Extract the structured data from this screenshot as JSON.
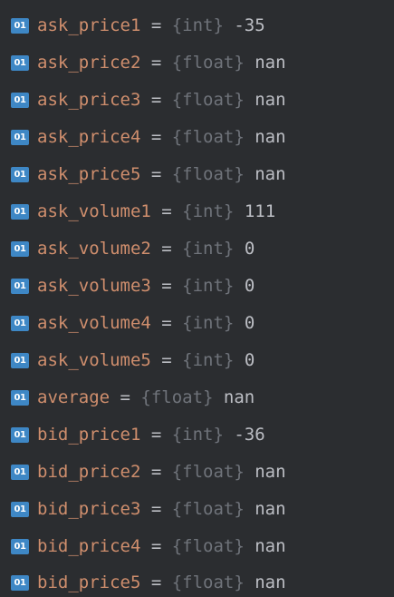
{
  "variables": [
    {
      "icon": "01",
      "name": "ask_price1",
      "eq": " = ",
      "type": "{int}",
      "value": " -35"
    },
    {
      "icon": "01",
      "name": "ask_price2",
      "eq": " = ",
      "type": "{float}",
      "value": " nan"
    },
    {
      "icon": "01",
      "name": "ask_price3",
      "eq": " = ",
      "type": "{float}",
      "value": " nan"
    },
    {
      "icon": "01",
      "name": "ask_price4",
      "eq": " = ",
      "type": "{float}",
      "value": " nan"
    },
    {
      "icon": "01",
      "name": "ask_price5",
      "eq": " = ",
      "type": "{float}",
      "value": " nan"
    },
    {
      "icon": "01",
      "name": "ask_volume1",
      "eq": " = ",
      "type": "{int}",
      "value": " 111"
    },
    {
      "icon": "01",
      "name": "ask_volume2",
      "eq": " = ",
      "type": "{int}",
      "value": " 0"
    },
    {
      "icon": "01",
      "name": "ask_volume3",
      "eq": " = ",
      "type": "{int}",
      "value": " 0"
    },
    {
      "icon": "01",
      "name": "ask_volume4",
      "eq": " = ",
      "type": "{int}",
      "value": " 0"
    },
    {
      "icon": "01",
      "name": "ask_volume5",
      "eq": " = ",
      "type": "{int}",
      "value": " 0"
    },
    {
      "icon": "01",
      "name": "average",
      "eq": " = ",
      "type": "{float}",
      "value": " nan"
    },
    {
      "icon": "01",
      "name": "bid_price1",
      "eq": " = ",
      "type": "{int}",
      "value": " -36"
    },
    {
      "icon": "01",
      "name": "bid_price2",
      "eq": " = ",
      "type": "{float}",
      "value": " nan"
    },
    {
      "icon": "01",
      "name": "bid_price3",
      "eq": " = ",
      "type": "{float}",
      "value": " nan"
    },
    {
      "icon": "01",
      "name": "bid_price4",
      "eq": " = ",
      "type": "{float}",
      "value": " nan"
    },
    {
      "icon": "01",
      "name": "bid_price5",
      "eq": " = ",
      "type": "{float}",
      "value": " nan"
    }
  ]
}
